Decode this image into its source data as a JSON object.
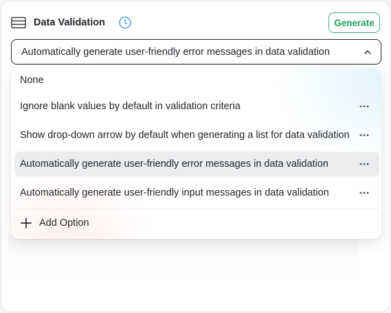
{
  "header": {
    "title": "Data Validation",
    "generate_label": "Generate"
  },
  "select": {
    "value": "Automatically generate user-friendly error messages in data validation"
  },
  "options": [
    {
      "label": "None",
      "has_more": false,
      "selected": false
    },
    {
      "label": "Ignore blank values by default in validation criteria",
      "has_more": true,
      "selected": false
    },
    {
      "label": "Show drop-down arrow by default when generating a list for data validation",
      "has_more": true,
      "selected": false
    },
    {
      "label": "Automatically generate user-friendly error messages in data validation",
      "has_more": true,
      "selected": true
    },
    {
      "label": "Automatically generate user-friendly input messages in data validation",
      "has_more": true,
      "selected": false
    }
  ],
  "add_option_label": "Add Option",
  "colors": {
    "accent_green": "#1f9d63",
    "clock_blue": "#4a9fd8",
    "selected_bg": "#ebedef"
  },
  "icons": {
    "header": "table-icon",
    "history": "clock-icon",
    "select": "chevron-up-icon",
    "row_action": "more-horizontal-icon",
    "add": "plus-icon"
  }
}
